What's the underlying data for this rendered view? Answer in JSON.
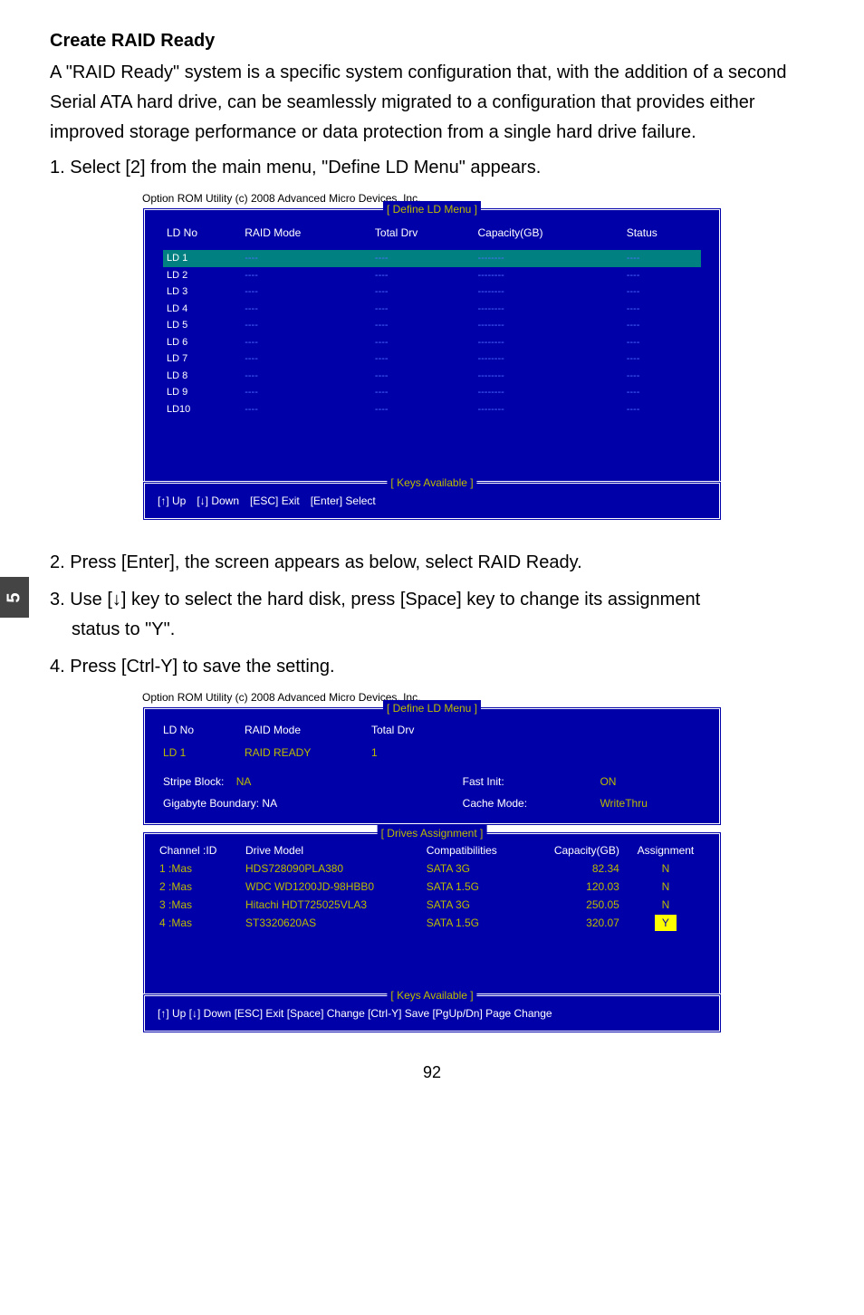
{
  "sideTab": "5",
  "heading": "Create RAID Ready",
  "intro": "A \"RAID Ready\" system is a specific system configuration that, with the addition of a second Serial ATA hard drive, can be seamlessly migrated to a configuration that provides either improved storage performance or data protection from a single hard drive failure.",
  "step1": "1. Select [2] from the main menu, \"Define LD Menu\" appears.",
  "bios1": {
    "caption": "Option ROM Utility (c) 2008 Advanced Micro Devices, Inc.",
    "title": "[ Define LD Menu ]",
    "headers": [
      "LD No",
      "RAID Mode",
      "Total Drv",
      "Capacity(GB)",
      "Status"
    ],
    "rows": [
      {
        "ld": "LD  1",
        "mode": "----",
        "drv": "----",
        "cap": "--------",
        "status": "----",
        "sel": true
      },
      {
        "ld": "LD  2",
        "mode": "----",
        "drv": "----",
        "cap": "--------",
        "status": "----"
      },
      {
        "ld": "LD  3",
        "mode": "----",
        "drv": "----",
        "cap": "--------",
        "status": "----"
      },
      {
        "ld": "LD  4",
        "mode": "----",
        "drv": "----",
        "cap": "--------",
        "status": "----"
      },
      {
        "ld": "LD  5",
        "mode": "----",
        "drv": "----",
        "cap": "--------",
        "status": "----"
      },
      {
        "ld": "LD  6",
        "mode": "----",
        "drv": "----",
        "cap": "--------",
        "status": "----"
      },
      {
        "ld": "LD  7",
        "mode": "----",
        "drv": "----",
        "cap": "--------",
        "status": "----"
      },
      {
        "ld": "LD  8",
        "mode": "----",
        "drv": "----",
        "cap": "--------",
        "status": "----"
      },
      {
        "ld": "LD  9",
        "mode": "----",
        "drv": "----",
        "cap": "--------",
        "status": "----"
      },
      {
        "ld": "LD10",
        "mode": "----",
        "drv": "----",
        "cap": "--------",
        "status": "----"
      }
    ],
    "keysTitle": "[ Keys Available ]",
    "keys": [
      "[↑] Up",
      "[↓] Down",
      "[ESC] Exit",
      "[Enter] Select"
    ]
  },
  "step2": "2. Press [Enter], the screen appears as below, select RAID Ready.",
  "step3a": "3. Use [↓] key to select the hard disk, press [Space] key to change its assignment",
  "step3b": "status to \"Y\".",
  "step4": "4. Press [Ctrl-Y] to save the setting.",
  "bios2": {
    "caption": "Option ROM Utility (c) 2008 Advanced Micro Devices, Inc.",
    "title": "[ Define LD Menu ]",
    "headerLabels": {
      "ldno": "LD No",
      "mode": "RAID Mode",
      "drv": "Total Drv"
    },
    "ld": {
      "no": "LD  1",
      "mode": "RAID READY",
      "drv": "1"
    },
    "stripeLabel": "Stripe Block:",
    "stripeVal": "NA",
    "fastLabel": "Fast Init:",
    "fastVal": "ON",
    "gbLabel": "Gigabyte Boundary: NA",
    "cacheLabel": "Cache Mode:",
    "cacheVal": "WriteThru",
    "drivesTitle": "[ Drives Assignment ]",
    "drivesHeaders": [
      "Channel :ID",
      "Drive Model",
      "Compatibilities",
      "Capacity(GB)",
      "Assignment"
    ],
    "drives": [
      {
        "ch": "1 :Mas",
        "model": "HDS728090PLA380",
        "comp": "SATA 3G",
        "cap": "82.34",
        "assign": "N"
      },
      {
        "ch": "2 :Mas",
        "model": "WDC WD1200JD-98HBB0",
        "comp": "SATA 1.5G",
        "cap": "120.03",
        "assign": "N"
      },
      {
        "ch": "3 :Mas",
        "model": "Hitachi HDT725025VLA3",
        "comp": "SATA 3G",
        "cap": "250.05",
        "assign": "N"
      },
      {
        "ch": "4 :Mas",
        "model": "ST3320620AS",
        "comp": "SATA 1.5G",
        "cap": "320.07",
        "assign": "Y",
        "hl": true
      }
    ],
    "keysTitle": "[ Keys Available ]",
    "keysLine": "[↑] Up  [↓] Down  [ESC] Exit  [Space] Change  [Ctrl-Y] Save   [PgUp/Dn] Page Change"
  },
  "pageNumber": "92"
}
